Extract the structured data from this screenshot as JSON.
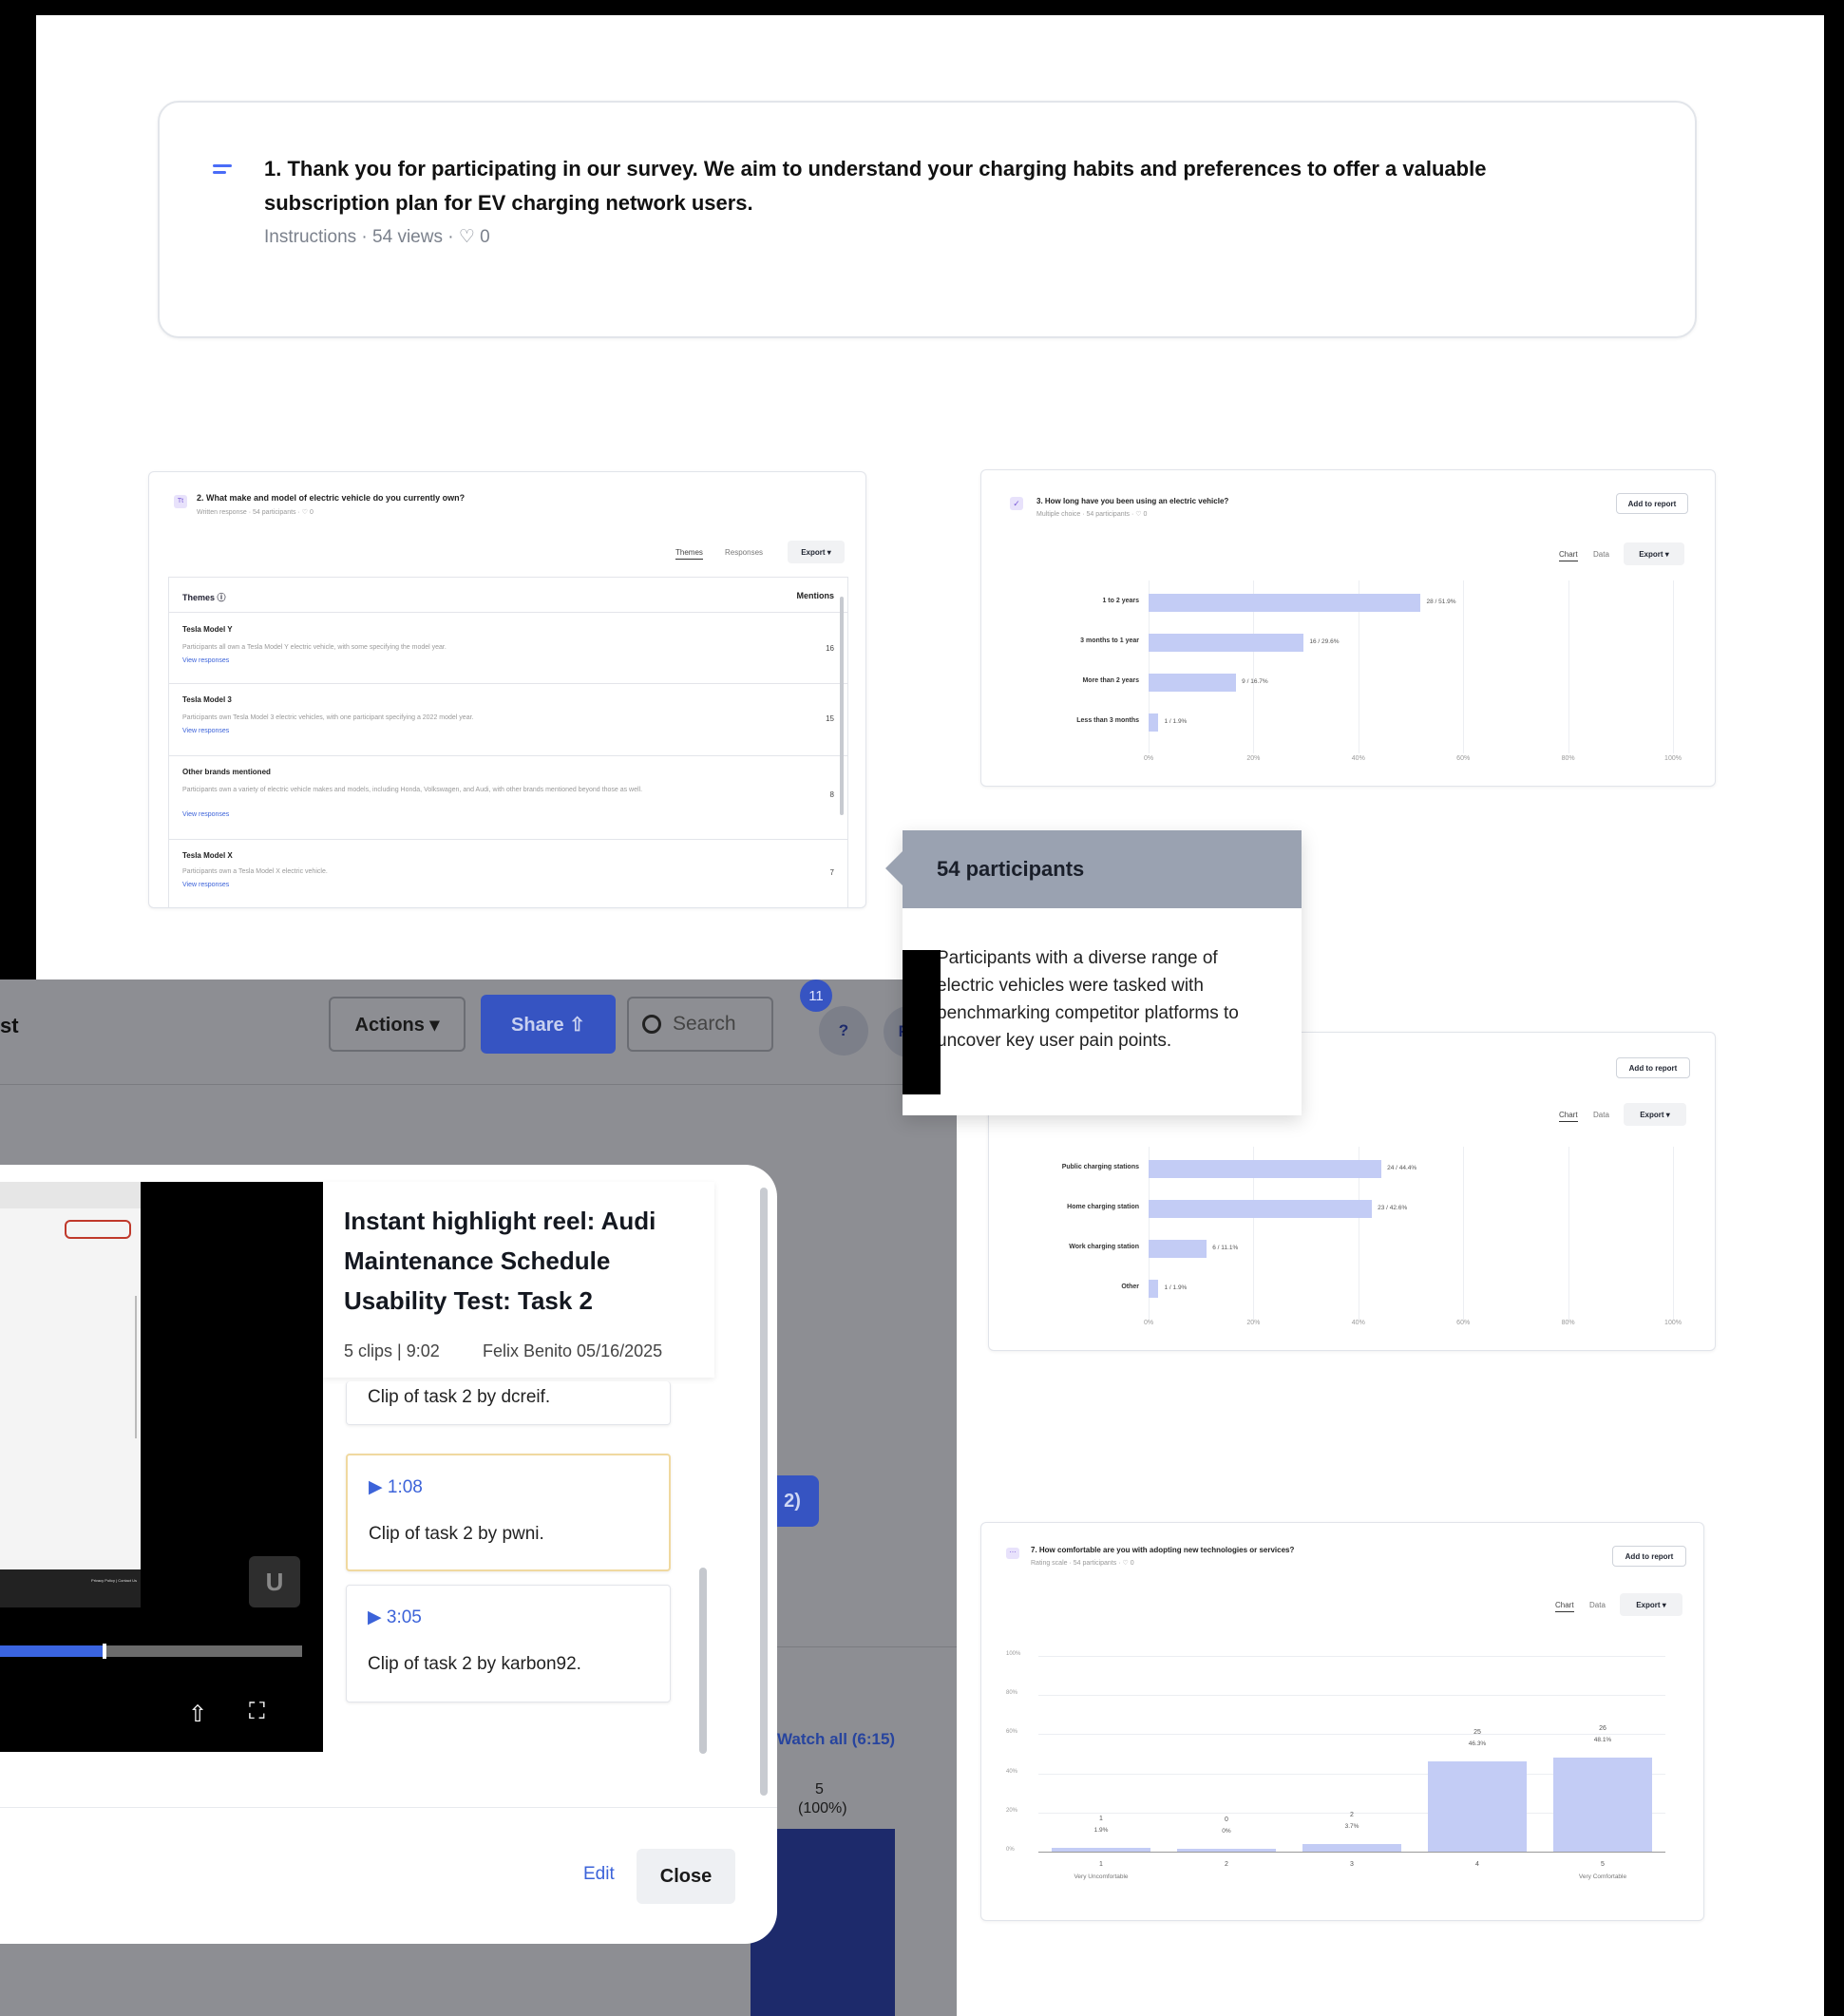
{
  "q1": {
    "title": "1. Thank you for participating in our survey. We aim to understand your charging habits and preferences to offer a valuable subscription plan for EV charging network users.",
    "meta": "Instructions · 54 views · ♡ 0"
  },
  "q2": {
    "title": "2. What make and model of electric vehicle do you currently own?",
    "meta": "Written response · 54 participants · ♡ 0",
    "tabs": [
      "Themes",
      "Responses"
    ],
    "export": "Export ▾",
    "col_themes": "Themes ⓘ",
    "col_mentions": "Mentions",
    "themes": [
      {
        "name": "Tesla Model Y",
        "desc": "Participants all own a Tesla Model Y electric vehicle, with some specifying the model year.",
        "link": "View responses",
        "count": "16"
      },
      {
        "name": "Tesla Model 3",
        "desc": "Participants own Tesla Model 3 electric vehicles, with one participant specifying a 2022 model year.",
        "link": "View responses",
        "count": "15"
      },
      {
        "name": "Other brands mentioned",
        "desc": "Participants own a variety of electric vehicle makes and models, including Honda, Volkswagen, and Audi, with other brands mentioned beyond those as well.",
        "link": "View responses",
        "count": "8"
      },
      {
        "name": "Tesla Model X",
        "desc": "Participants own a Tesla Model X electric vehicle.",
        "link": "View responses",
        "count": "7"
      }
    ]
  },
  "q3": {
    "title": "3. How long have you been using an electric vehicle?",
    "meta": "Multiple choice · 54 participants · ♡ 0",
    "add": "Add to report",
    "tabs": [
      "Chart",
      "Data"
    ],
    "export": "Export ▾"
  },
  "q4": {
    "add": "Add to report",
    "tabs": [
      "Chart",
      "Data"
    ],
    "export": "Export ▾"
  },
  "q7": {
    "title": "7. How comfortable are you with adopting new technologies or services?",
    "meta": "Rating scale · 54 participants · ♡ 0",
    "add": "Add to report",
    "tabs": [
      "Chart",
      "Data"
    ],
    "export": "Export ▾"
  },
  "chart_data": [
    {
      "type": "bar",
      "orientation": "horizontal",
      "categories": [
        "1 to 2 years",
        "3 months to 1 year",
        "More than 2 years",
        "Less than 3 months"
      ],
      "values": [
        28,
        16,
        9,
        1
      ],
      "labels": [
        "28 / 51.9%",
        "16 / 29.6%",
        "9 / 16.7%",
        "1 / 1.9%"
      ],
      "xlim": [
        0,
        100
      ],
      "ticks": [
        "0%",
        "20%",
        "40%",
        "60%",
        "80%",
        "100%"
      ],
      "percent": [
        51.9,
        29.6,
        16.7,
        1.9
      ]
    },
    {
      "type": "bar",
      "orientation": "horizontal",
      "categories": [
        "Public charging stations",
        "Home charging station",
        "Work charging station",
        "Other"
      ],
      "values": [
        24,
        23,
        6,
        1
      ],
      "labels": [
        "24 / 44.4%",
        "23 / 42.6%",
        "6 / 11.1%",
        "1 / 1.9%"
      ],
      "xlim": [
        0,
        100
      ],
      "ticks": [
        "0%",
        "20%",
        "40%",
        "60%",
        "80%",
        "100%"
      ],
      "percent": [
        44.4,
        42.6,
        11.1,
        1.9
      ]
    },
    {
      "type": "bar",
      "orientation": "vertical",
      "categories": [
        "1",
        "2",
        "3",
        "4",
        "5"
      ],
      "sublabels": [
        "Very Uncomfortable",
        "",
        "",
        "",
        "Very Comfortable"
      ],
      "values": [
        1,
        0,
        2,
        25,
        26
      ],
      "pct_labels": [
        "1.9%",
        "0%",
        "3.7%",
        "46.3%",
        "48.1%"
      ],
      "percent": [
        1.9,
        0,
        3.7,
        46.3,
        48.1
      ],
      "ylim": [
        0,
        100
      ],
      "yticks": [
        "100%",
        "80%",
        "60%",
        "40%",
        "20%",
        "0%"
      ]
    }
  ],
  "tooltip": {
    "title": "54 participants",
    "body": "Participants with a diverse range of electric vehicles were tasked with benchmarking competitor platforms to uncover key user pain points."
  },
  "topbar": {
    "title_fragment": "st",
    "actions": "Actions ▾",
    "share": "Share ⇧",
    "search_placeholder": "Search",
    "badge": "11",
    "help": "?",
    "avatar": "FB"
  },
  "background": {
    "pill": "2)",
    "watch_all": "Watch all (6:15)",
    "bar_value": "5",
    "bar_pct": "(100%)"
  },
  "modal": {
    "title": "Instant highlight reel: Audi Maintenance Schedule Usability Test: Task 2",
    "meta_clips": "5 clips | 9:02",
    "meta_author": "Felix Benito  05/16/2025",
    "clips": [
      {
        "time": "",
        "text": "Clip of task 2 by dcreif."
      },
      {
        "time": "▶ 1:08",
        "text": "Clip of task 2 by pwni."
      },
      {
        "time": "▶ 3:05",
        "text": "Clip of task 2 by karbon92."
      }
    ],
    "edit": "Edit",
    "close": "Close",
    "video_watermark": "U",
    "video_footer": "Privacy Policy | Contact Us"
  },
  "colors": {
    "accent": "#3c63d9",
    "bar": "#c3ccf5",
    "tooltip_header": "#9aa2b1",
    "overlay": "#8d8e93",
    "dark_bar": "#1d2a6b"
  }
}
